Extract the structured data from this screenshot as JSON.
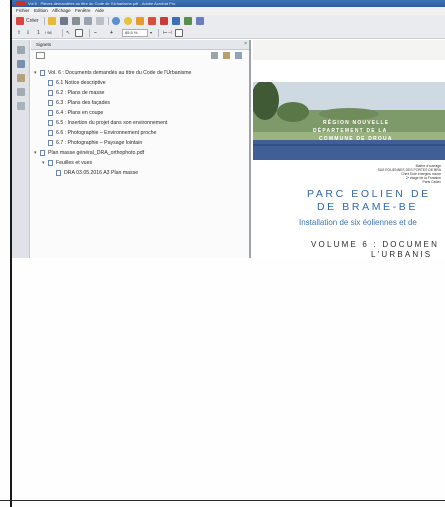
{
  "window": {
    "title": "Vol 6 · Pièces demandées au titre du Code de l'Urbanisme.pdf - Adobe Acrobat Pro"
  },
  "menu": {
    "items": [
      "Fichier",
      "Edition",
      "Affichage",
      "Fenêtre",
      "Aide"
    ]
  },
  "toolbar": {
    "create_label": "Créer",
    "page_number": "1",
    "page_total": "/ 96",
    "zoom_value": "85,5 %"
  },
  "bookmarks": {
    "panel_title": "Signets",
    "items": [
      {
        "level": 0,
        "text": "Vol. 6 : Documents demandés au titre du Code de l'Urbanisme"
      },
      {
        "level": 1,
        "text": "6.1 Notice descriptive"
      },
      {
        "level": 1,
        "text": "6.2 : Plans de masse"
      },
      {
        "level": 1,
        "text": "6.3 : Plans des façades"
      },
      {
        "level": 1,
        "text": "6.4 : Plans en coupe"
      },
      {
        "level": 1,
        "text": "6.5 : Insertion du projet dans son environnement"
      },
      {
        "level": 1,
        "text": "6.6 : Photographie – Environnement proche"
      },
      {
        "level": 1,
        "text": "6.7 : Photographie – Paysage lointain"
      },
      {
        "level": 0,
        "text": "Plan masse général_DRA_orthophoto.pdf"
      },
      {
        "level": 1,
        "text": "Feuilles et vues"
      },
      {
        "level": 2,
        "text": "DRA 03.05.2016 A3 Plan masse"
      }
    ]
  },
  "document": {
    "banner_lines": [
      "RÉGION NOUVELLE",
      "DÉPARTEMENT DE LA",
      "COMMUNE DE DROUA"
    ],
    "credits": [
      "Maître d'ouvrage",
      "SAS EOLIENNES DES PORTES DE BRA",
      "Chez Eole énergies nouve",
      "2ᵉ étage de la Fontaine",
      "Paris Cedex"
    ],
    "title_line1": "PARC EOLIEN DE",
    "title_line2": "DE BRAME-BE",
    "subtitle": "Installation de six éoliennes et de",
    "volume_line1": "VOLUME 6 : DOCUMEN",
    "volume_line2": "L'URBANIS"
  },
  "colors": {
    "title_blue": "#2f6aa6",
    "window_blue": "#3f74b8"
  }
}
